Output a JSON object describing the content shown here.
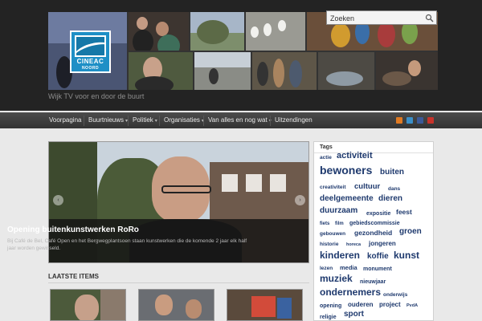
{
  "search": {
    "placeholder": "Zoeken"
  },
  "logo": {
    "name": "CINEAC",
    "subtitle": "NOORD"
  },
  "header": {
    "tagline": "Wijk TV voor en door de buurt"
  },
  "nav": {
    "items": [
      {
        "label": "Voorpagina",
        "has_dropdown": false
      },
      {
        "label": "Buurtnieuws",
        "has_dropdown": true
      },
      {
        "label": "Politiek",
        "has_dropdown": true
      },
      {
        "label": "Organisaties",
        "has_dropdown": true
      },
      {
        "label": "Van alles en nog wat",
        "has_dropdown": true
      },
      {
        "label": "Uitzendingen",
        "has_dropdown": false
      }
    ],
    "dropdown_arrow": "▾",
    "social_icons": [
      {
        "name": "rss-icon",
        "color": "#e07a22"
      },
      {
        "name": "twitter-icon",
        "color": "#3a8fc8"
      },
      {
        "name": "facebook-icon",
        "color": "#3b5998"
      },
      {
        "name": "youtube-icon",
        "color": "#c8332b"
      }
    ]
  },
  "featured": {
    "title": "Opening buitenkunstwerken RoRo",
    "description": "Bij Café de Bel, Café Open en het Bergwegplantsoen staan kunstwerken die de komende 2 jaar elk half jaar worden gewisseld.",
    "prev_label": "‹",
    "next_label": "›"
  },
  "latest": {
    "title": "LAATSTE ITEMS"
  },
  "sidebar": {
    "title": "Tags",
    "tags": [
      {
        "label": "actie",
        "size": 6.5
      },
      {
        "label": "activiteit",
        "size": 11
      },
      {
        "label": "bewoners",
        "size": 14
      },
      {
        "label": "buiten",
        "size": 10
      },
      {
        "label": "creativiteit",
        "size": 6.5
      },
      {
        "label": "cultuur",
        "size": 9.5
      },
      {
        "label": "dans",
        "size": 6.5
      },
      {
        "label": "deelgemeente",
        "size": 10
      },
      {
        "label": "dieren",
        "size": 10
      },
      {
        "label": "duurzaam",
        "size": 10
      },
      {
        "label": "expositie",
        "size": 7
      },
      {
        "label": "feest",
        "size": 8.5
      },
      {
        "label": "fiets",
        "size": 6
      },
      {
        "label": "film",
        "size": 6
      },
      {
        "label": "gebiedscommissie",
        "size": 7
      },
      {
        "label": "gebouwen",
        "size": 6.5
      },
      {
        "label": "gezondheid",
        "size": 8.5
      },
      {
        "label": "groen",
        "size": 10
      },
      {
        "label": "historie",
        "size": 6.5
      },
      {
        "label": "horeca",
        "size": 5.5
      },
      {
        "label": "jongeren",
        "size": 8
      },
      {
        "label": "kinderen",
        "size": 12
      },
      {
        "label": "koffie",
        "size": 10
      },
      {
        "label": "kunst",
        "size": 12
      },
      {
        "label": "lezen",
        "size": 6.5
      },
      {
        "label": "media",
        "size": 7.5
      },
      {
        "label": "monument",
        "size": 7
      },
      {
        "label": "muziek",
        "size": 12
      },
      {
        "label": "nieuwjaar",
        "size": 7
      },
      {
        "label": "ondernemers",
        "size": 12
      },
      {
        "label": "onderwijs",
        "size": 6.5
      },
      {
        "label": "opening",
        "size": 7
      },
      {
        "label": "ouderen",
        "size": 8
      },
      {
        "label": "project",
        "size": 8
      },
      {
        "label": "PvdA",
        "size": 5.5
      },
      {
        "label": "religie",
        "size": 7
      },
      {
        "label": "sport",
        "size": 10
      }
    ]
  }
}
